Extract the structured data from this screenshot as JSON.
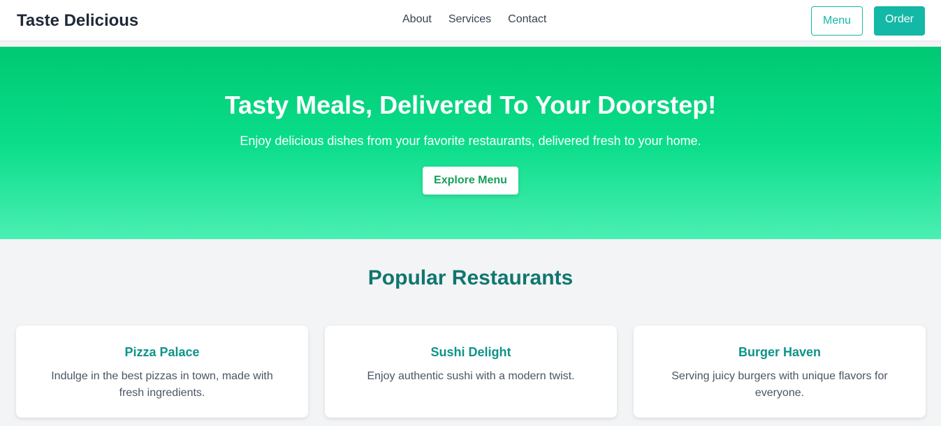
{
  "navbar": {
    "brand": "Taste Delicious",
    "links": [
      {
        "label": "About"
      },
      {
        "label": "Services"
      },
      {
        "label": "Contact"
      }
    ],
    "menu_button": "Menu",
    "order_button": "Order"
  },
  "hero": {
    "title": "Tasty Meals, Delivered To Your Doorstep!",
    "subtitle": "Enjoy delicious dishes from your favorite restaurants, delivered fresh to your home.",
    "cta": "Explore Menu"
  },
  "popular": {
    "title": "Popular Restaurants",
    "restaurants": [
      {
        "name": "Pizza Palace",
        "description": "Indulge in the best pizzas in town, made with fresh ingredients."
      },
      {
        "name": "Sushi Delight",
        "description": "Enjoy authentic sushi with a modern twist."
      },
      {
        "name": "Burger Haven",
        "description": "Serving juicy burgers with unique flavors for everyone."
      }
    ]
  },
  "colors": {
    "accent": "#14b8a6",
    "hero_top": "#00c972",
    "hero_bottom": "#4befb3",
    "heading": "#0f766e"
  }
}
